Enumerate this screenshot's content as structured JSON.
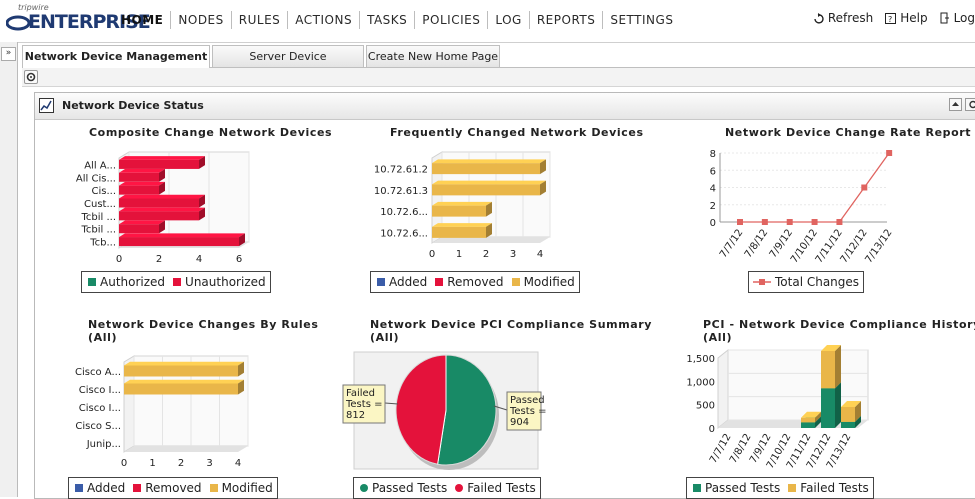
{
  "app": {
    "logo_small": "tripwire",
    "logo_big": "ENTERPRISE"
  },
  "nav": [
    "HOME",
    "NODES",
    "RULES",
    "ACTIONS",
    "TASKS",
    "POLICIES",
    "LOG",
    "REPORTS",
    "SETTINGS"
  ],
  "util": {
    "refresh": "Refresh",
    "help": "Help",
    "logout": "Log"
  },
  "tabs": [
    "Network Device Management",
    "Server Device Management",
    "Create New Home Page"
  ],
  "panel": {
    "title": "Network Device Status"
  },
  "colors": {
    "red": "#e4123b",
    "green": "#188a66",
    "gold": "#e9b649",
    "blue": "#3a5ca8",
    "line": "#e06460"
  },
  "charts": {
    "c1": {
      "title": "Composite Change Network Devices",
      "legend": [
        "Authorized",
        "Unauthorized"
      ]
    },
    "c2": {
      "title": "Frequently Changed Network Devices",
      "legend": [
        "Added",
        "Removed",
        "Modified"
      ]
    },
    "c3": {
      "title": "Network Device Change Rate Report",
      "legend": [
        "Total Changes"
      ]
    },
    "c4": {
      "title": "Network Device Changes By Rules",
      "subtitle": "(All)",
      "legend": [
        "Added",
        "Removed",
        "Modified"
      ]
    },
    "c5": {
      "title": "Network Device PCI Compliance Summary",
      "subtitle": "(All)",
      "legend": [
        "Passed Tests",
        "Failed Tests"
      ],
      "failed_label": "Failed\nTests =\n812",
      "passed_label": "Passed\nTests =\n904"
    },
    "c6": {
      "title": "PCI - Network Device Compliance History",
      "subtitle": "(All)",
      "legend": [
        "Passed Tests",
        "Failed Tests"
      ]
    }
  },
  "chart_data": [
    {
      "type": "bar",
      "orientation": "horizontal",
      "title": "Composite Change Network Devices",
      "categories": [
        "All A...",
        "All Cis...",
        "Cis...",
        "Cust...",
        "Tcbil ...",
        "Tcbil ...",
        "Tcb..."
      ],
      "series": [
        {
          "name": "Authorized",
          "values": [
            0,
            0,
            0,
            0,
            0,
            0,
            0
          ]
        },
        {
          "name": "Unauthorized",
          "values": [
            4,
            2,
            2,
            4,
            4,
            2,
            6
          ]
        }
      ],
      "xlim": [
        0,
        6
      ],
      "xticks": [
        0,
        2,
        4,
        6
      ],
      "legend_position": "bottom"
    },
    {
      "type": "bar",
      "orientation": "horizontal",
      "title": "Frequently Changed Network Devices",
      "categories": [
        "10.72.61.2",
        "10.72.61.3",
        "10.72.6...",
        "10.72.6..."
      ],
      "series": [
        {
          "name": "Added",
          "values": [
            0,
            0,
            0,
            0
          ]
        },
        {
          "name": "Removed",
          "values": [
            0,
            0,
            0,
            0
          ]
        },
        {
          "name": "Modified",
          "values": [
            4,
            4,
            2,
            2
          ]
        }
      ],
      "xlim": [
        0,
        4
      ],
      "xticks": [
        0,
        1,
        2,
        3,
        4
      ],
      "legend_position": "bottom"
    },
    {
      "type": "line",
      "title": "Network Device Change Rate Report",
      "x": [
        "7/7/12",
        "7/8/12",
        "7/9/12",
        "7/10/12",
        "7/11/12",
        "7/12/12",
        "7/13/12"
      ],
      "series": [
        {
          "name": "Total Changes",
          "values": [
            0,
            0,
            0,
            0,
            0,
            4,
            8
          ]
        }
      ],
      "ylim": [
        0,
        8
      ],
      "yticks": [
        0,
        2,
        4,
        6,
        8
      ],
      "grid": true,
      "legend_position": "bottom"
    },
    {
      "type": "bar",
      "orientation": "horizontal",
      "title": "Network Device Changes By Rules",
      "subtitle": "(All)",
      "categories": [
        "Cisco A...",
        "Cisco I...",
        "Cisco I...",
        "Cisco S...",
        "Junip..."
      ],
      "series": [
        {
          "name": "Added",
          "values": [
            0,
            0,
            0,
            0,
            0
          ]
        },
        {
          "name": "Removed",
          "values": [
            0,
            0,
            0,
            0,
            0
          ]
        },
        {
          "name": "Modified",
          "values": [
            4,
            4,
            0,
            0,
            0
          ]
        }
      ],
      "xlim": [
        0,
        4
      ],
      "xticks": [
        0,
        1,
        2,
        3,
        4
      ],
      "legend_position": "bottom"
    },
    {
      "type": "pie",
      "title": "Network Device PCI Compliance Summary",
      "subtitle": "(All)",
      "slices": [
        {
          "name": "Passed Tests",
          "value": 904
        },
        {
          "name": "Failed Tests",
          "value": 812
        }
      ],
      "legend_position": "bottom"
    },
    {
      "type": "bar",
      "stacked": true,
      "title": "PCI - Network Device Compliance History",
      "subtitle": "(All)",
      "categories": [
        "7/7/12",
        "7/8/12",
        "7/9/12",
        "7/10/12",
        "7/11/12",
        "7/12/12",
        "7/13/12"
      ],
      "series": [
        {
          "name": "Passed Tests",
          "values": [
            0,
            0,
            0,
            0,
            120,
            850,
            130
          ]
        },
        {
          "name": "Failed Tests",
          "values": [
            0,
            0,
            0,
            0,
            100,
            800,
            320
          ]
        }
      ],
      "ylim": [
        0,
        1500
      ],
      "yticks": [
        "0",
        "500",
        "1,000",
        "1,500"
      ],
      "legend_position": "bottom"
    }
  ]
}
